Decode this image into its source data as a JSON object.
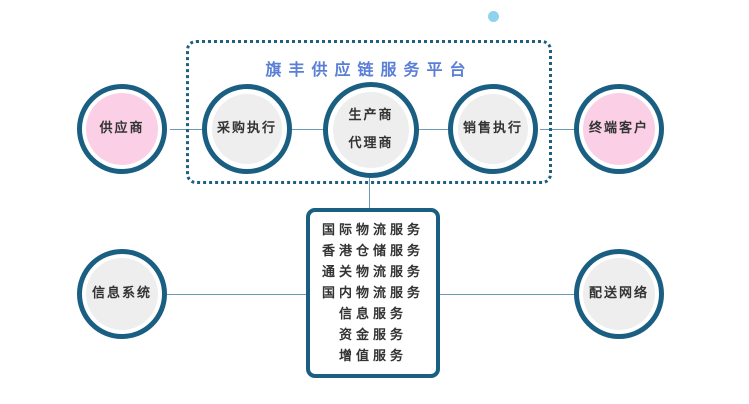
{
  "platform": {
    "title": "旗丰供应链服务平台"
  },
  "nodes": {
    "supplier": "供应商",
    "procurement": "采购执行",
    "manufacturer_line1": "生产商",
    "manufacturer_line2": "代理商",
    "sales": "销售执行",
    "end_customer": "终端客户",
    "info_system": "信息系统",
    "delivery_network": "配送网络"
  },
  "services": [
    "国际物流服务",
    "香港仓储服务",
    "通关物流服务",
    "国内物流服务",
    "信息服务",
    "资金服务",
    "增值服务"
  ],
  "colors": {
    "ring": "#1a5f82",
    "title": "#5a7fd6",
    "pink_fill": "#fbd0e6",
    "gray_fill": "#eeeeee",
    "accent_dot": "#8fd2ef"
  }
}
